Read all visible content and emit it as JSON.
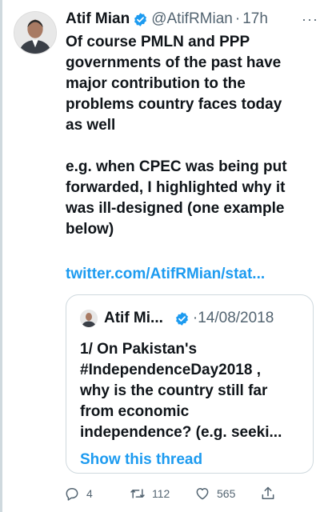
{
  "tweet": {
    "author_name": "Atif Mian",
    "handle": "@AtifRMian",
    "separator": "·",
    "time": "17h",
    "more_label": "···",
    "paragraphs": [
      "Of course PMLN and PPP\ngovernments of the past have\nmajor contribution to the\nproblems country faces today\nas well",
      "e.g. when CPEC was being put\nforwarded, I highlighted why it\nwas ill-designed (one example\nbelow)"
    ],
    "link_text": "twitter.com/AtifRMian/stat..."
  },
  "quote": {
    "author_name": "Atif Mi...",
    "separator": "·",
    "date": "14/08/2018",
    "text": "1/ On Pakistan's\n#IndependenceDay2018 ,\nwhy is the country still far\nfrom economic\nindependence? (e.g. seeki...",
    "show_thread": "Show this thread"
  },
  "actions": {
    "replies": "4",
    "retweets": "112",
    "likes": "565"
  },
  "colors": {
    "accent": "#1d9bf0",
    "secondary_text": "#536471",
    "border": "#cfd9de"
  },
  "icons": [
    "verified-badge-icon",
    "more-icon",
    "reply-icon",
    "retweet-icon",
    "like-icon",
    "share-icon"
  ]
}
